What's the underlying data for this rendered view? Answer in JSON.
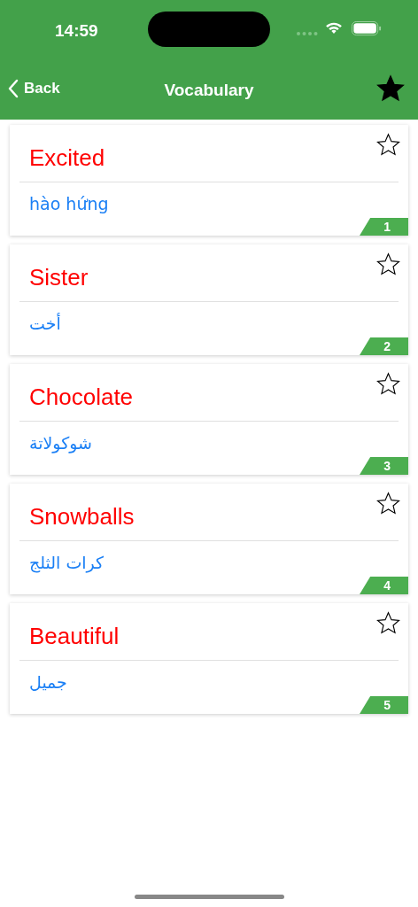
{
  "status_bar": {
    "time": "14:59"
  },
  "nav": {
    "back": "Back",
    "title": "Vocabulary"
  },
  "cards": [
    {
      "word": "Excited",
      "translation": "hào hứng",
      "number": "1",
      "favorite": false
    },
    {
      "word": "Sister",
      "translation": "أخت",
      "number": "2",
      "favorite": false
    },
    {
      "word": "Chocolate",
      "translation": "شوكولاتة",
      "number": "3",
      "favorite": false
    },
    {
      "word": "Snowballs",
      "translation": "كرات الثلج",
      "number": "4",
      "favorite": false
    },
    {
      "word": "Beautiful",
      "translation": "جميل",
      "number": "5",
      "favorite": false
    }
  ]
}
